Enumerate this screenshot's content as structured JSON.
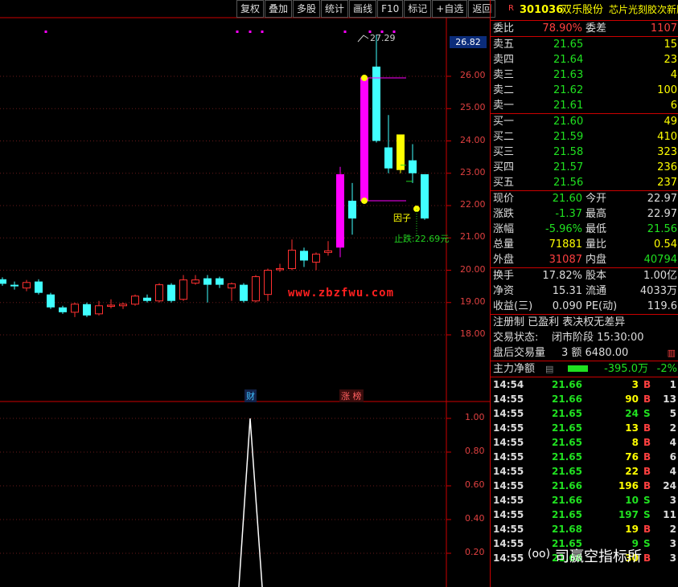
{
  "toolbar": [
    "复权",
    "叠加",
    "多股",
    "统计",
    "画线",
    "F10",
    "标记",
    "+自选",
    "返回"
  ],
  "kline": {
    "current_price_tag": "26.82",
    "high_label": "27.29",
    "factor_label": "因子",
    "stop_label": "止跌:22.69元",
    "watermark": "www.zbzfwu.com",
    "badge_cai": "财",
    "badge_zt": "涨 榜",
    "y_ticks": [
      "26.00",
      "25.00",
      "24.00",
      "23.00",
      "22.00",
      "21.00",
      "20.00",
      "19.00",
      "18.00"
    ],
    "colors": {
      "up": "#ff3030",
      "down": "#40ffff",
      "magenta": "#ff00ff",
      "yellow": "#ffff00"
    },
    "candles": [
      {
        "o": 19.72,
        "c": 19.58,
        "h": 19.78,
        "l": 19.52
      },
      {
        "o": 19.55,
        "c": 19.5,
        "h": 19.65,
        "l": 19.4
      },
      {
        "o": 19.45,
        "c": 19.62,
        "h": 19.7,
        "l": 19.35
      },
      {
        "o": 19.65,
        "c": 19.3,
        "h": 19.72,
        "l": 19.25
      },
      {
        "o": 19.25,
        "c": 18.85,
        "h": 19.3,
        "l": 18.8
      },
      {
        "o": 18.85,
        "c": 18.7,
        "h": 18.9,
        "l": 18.65
      },
      {
        "o": 18.7,
        "c": 18.95,
        "h": 19.0,
        "l": 18.55
      },
      {
        "o": 18.95,
        "c": 18.6,
        "h": 19.0,
        "l": 18.55
      },
      {
        "o": 18.65,
        "c": 18.9,
        "h": 19.05,
        "l": 18.6
      },
      {
        "o": 18.9,
        "c": 18.92,
        "h": 19.1,
        "l": 18.82
      },
      {
        "o": 18.9,
        "c": 18.95,
        "h": 19.0,
        "l": 18.8
      },
      {
        "o": 18.95,
        "c": 19.2,
        "h": 19.25,
        "l": 18.9
      },
      {
        "o": 19.15,
        "c": 19.05,
        "h": 19.25,
        "l": 19.0
      },
      {
        "o": 19.05,
        "c": 19.55,
        "h": 19.6,
        "l": 19.0
      },
      {
        "o": 19.55,
        "c": 19.05,
        "h": 19.6,
        "l": 19.0
      },
      {
        "o": 19.1,
        "c": 19.7,
        "h": 19.85,
        "l": 19.05
      },
      {
        "o": 19.6,
        "c": 19.7,
        "h": 19.85,
        "l": 19.55
      },
      {
        "o": 19.75,
        "c": 19.55,
        "h": 19.85,
        "l": 19.0
      },
      {
        "o": 19.75,
        "c": 19.55,
        "h": 19.8,
        "l": 19.45
      },
      {
        "o": 19.45,
        "c": 19.58,
        "h": 19.62,
        "l": 19.05
      },
      {
        "o": 19.55,
        "c": 19.05,
        "h": 19.6,
        "l": 19.0
      },
      {
        "o": 19.05,
        "c": 19.8,
        "h": 19.85,
        "l": 19.0
      },
      {
        "o": 19.25,
        "c": 20.0,
        "h": 20.05,
        "l": 19.05
      },
      {
        "o": 20.05,
        "c": 20.05,
        "h": 20.2,
        "l": 19.95
      },
      {
        "o": 20.05,
        "c": 20.62,
        "h": 20.95,
        "l": 20.0
      },
      {
        "o": 20.6,
        "c": 20.3,
        "h": 20.7,
        "l": 20.1
      },
      {
        "o": 20.25,
        "c": 20.5,
        "h": 20.55,
        "l": 20.0
      },
      {
        "o": 20.55,
        "c": 20.6,
        "h": 20.9,
        "l": 20.45
      },
      {
        "o": 20.7,
        "c": 22.97,
        "h": 23.2,
        "l": 20.4
      },
      {
        "o": 22.15,
        "c": 21.6,
        "h": 22.7,
        "l": 21.1
      },
      {
        "o": 22.15,
        "c": 25.95,
        "h": 26.05,
        "l": 22.1
      },
      {
        "o": 26.3,
        "c": 24.0,
        "h": 27.29,
        "l": 23.95
      },
      {
        "o": 23.8,
        "c": 23.15,
        "h": 24.8,
        "l": 23.0
      },
      {
        "o": 23.1,
        "c": 24.2,
        "h": 24.2,
        "l": 23.0
      },
      {
        "o": 23.4,
        "c": 23.0,
        "h": 23.9,
        "l": 22.7
      },
      {
        "o": 22.97,
        "c": 21.6,
        "h": 22.97,
        "l": 21.56
      }
    ],
    "indicator_ticks": [
      "1.00",
      "0.80",
      "0.60",
      "0.40",
      "0.20"
    ]
  },
  "stock": {
    "r_badge": "R",
    "code": "301036",
    "name": "双乐股份",
    "concept": "芯片光刻胶次新股"
  },
  "quote": {
    "weibi_label": "委比",
    "weibi_value": "78.90%",
    "weicha_label": "委差",
    "weicha_value": "1107",
    "asks": [
      {
        "label": "卖五",
        "price": "21.65",
        "vol": "15"
      },
      {
        "label": "卖四",
        "price": "21.64",
        "vol": "23"
      },
      {
        "label": "卖三",
        "price": "21.63",
        "vol": "4"
      },
      {
        "label": "卖二",
        "price": "21.62",
        "vol": "100"
      },
      {
        "label": "卖一",
        "price": "21.61",
        "vol": "6"
      }
    ],
    "bids": [
      {
        "label": "买一",
        "price": "21.60",
        "vol": "49"
      },
      {
        "label": "买二",
        "price": "21.59",
        "vol": "410"
      },
      {
        "label": "买三",
        "price": "21.58",
        "vol": "323"
      },
      {
        "label": "买四",
        "price": "21.57",
        "vol": "236"
      },
      {
        "label": "买五",
        "price": "21.56",
        "vol": "237"
      }
    ],
    "stats": [
      {
        "l1": "现价",
        "v1": "21.60",
        "c1": "green",
        "l2": "今开",
        "v2": "22.97",
        "c2": "white"
      },
      {
        "l1": "涨跌",
        "v1": "-1.37",
        "c1": "green",
        "l2": "最高",
        "v2": "22.97",
        "c2": "white"
      },
      {
        "l1": "涨幅",
        "v1": "-5.96%",
        "c1": "green",
        "l2": "最低",
        "v2": "21.56",
        "c2": "green"
      },
      {
        "l1": "总量",
        "v1": "71881",
        "c1": "yellow",
        "l2": "量比",
        "v2": "0.54",
        "c2": "yellow"
      },
      {
        "l1": "外盘",
        "v1": "31087",
        "c1": "red",
        "l2": "内盘",
        "v2": "40794",
        "c2": "green"
      }
    ],
    "stats2": [
      {
        "l1": "换手",
        "v1": "17.82%",
        "l2": "股本",
        "v2": "1.00亿"
      },
      {
        "l1": "净资",
        "v1": "15.31",
        "l2": "流通",
        "v2": "4033万"
      },
      {
        "l1": "收益(三)",
        "v1": "0.090",
        "l2": "PE(动)",
        "v2": "119.6"
      }
    ],
    "register_text": "注册制 已盈利 表决权无差异",
    "status_label": "交易状态:",
    "status_value": "闭市阶段 15:30:00",
    "after_label": "盘后交易量",
    "after_value": "3 额 6480.00",
    "net_label": "主力净额",
    "net_value": "-395.0万",
    "net_pct": "-2%",
    "net_fill": 0.25
  },
  "trades": [
    {
      "t": "14:54",
      "p": "21.66",
      "v": "3",
      "bs": "B",
      "n": "1"
    },
    {
      "t": "14:55",
      "p": "21.66",
      "v": "90",
      "bs": "B",
      "n": "13"
    },
    {
      "t": "14:55",
      "p": "21.65",
      "v": "24",
      "bs": "S",
      "n": "5"
    },
    {
      "t": "14:55",
      "p": "21.65",
      "v": "13",
      "bs": "B",
      "n": "2"
    },
    {
      "t": "14:55",
      "p": "21.65",
      "v": "8",
      "bs": "B",
      "n": "4"
    },
    {
      "t": "14:55",
      "p": "21.65",
      "v": "76",
      "bs": "B",
      "n": "6"
    },
    {
      "t": "14:55",
      "p": "21.65",
      "v": "22",
      "bs": "B",
      "n": "4"
    },
    {
      "t": "14:55",
      "p": "21.66",
      "v": "196",
      "bs": "B",
      "n": "24"
    },
    {
      "t": "14:55",
      "p": "21.66",
      "v": "10",
      "bs": "S",
      "n": "3"
    },
    {
      "t": "14:55",
      "p": "21.65",
      "v": "197",
      "bs": "S",
      "n": "11"
    },
    {
      "t": "14:55",
      "p": "21.68",
      "v": "19",
      "bs": "B",
      "n": "2"
    },
    {
      "t": "14:55",
      "p": "21.65",
      "v": "9",
      "bs": "S",
      "n": "3"
    },
    {
      "t": "14:55",
      "p": "21.66",
      "v": "30",
      "bs": "B",
      "n": "3"
    }
  ],
  "logo": {
    "mark": "(oo)",
    "text": "司赢空指标所"
  }
}
